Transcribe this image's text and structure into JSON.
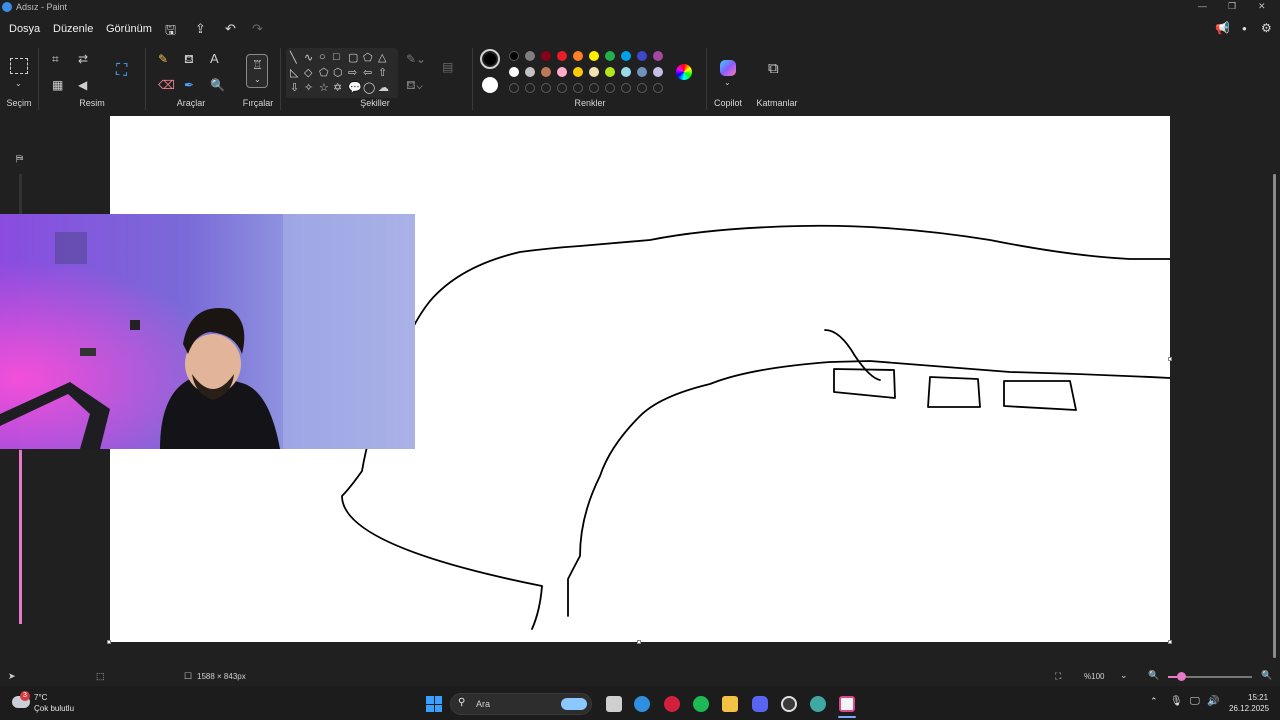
{
  "window": {
    "title": "Adsız - Paint"
  },
  "menu": {
    "file": "Dosya",
    "edit": "Düzenle",
    "view": "Görünüm"
  },
  "ribbon": {
    "groups": {
      "selection": "Seçim",
      "image": "Resim",
      "tools": "Araçlar",
      "brushes": "Fırçalar",
      "shapes": "Şekiller",
      "colors": "Renkler",
      "copilot": "Copilot",
      "layers": "Katmanlar"
    },
    "palette_row1": [
      "#000000",
      "#7f7f7f",
      "#880015",
      "#ed1c24",
      "#ff7f27",
      "#fff200",
      "#22b14c",
      "#00a2e8",
      "#3f48cc",
      "#a349a4"
    ],
    "palette_row2": [
      "#ffffff",
      "#c3c3c3",
      "#b97a57",
      "#ffaec9",
      "#ffc90e",
      "#efe4b0",
      "#b5e61d",
      "#99d9ea",
      "#7092be",
      "#c8bfe7"
    ],
    "primary_color": "#000000",
    "secondary_color": "#ffffff"
  },
  "status": {
    "canvas_size": "1588 × 843px",
    "zoom": "%100"
  },
  "taskbar": {
    "weather_temp": "7°C",
    "weather_desc": "Çok bulutlu",
    "weather_badge": "3",
    "search_placeholder": "Ara",
    "time": "15:21",
    "date": "26.12.2025"
  }
}
